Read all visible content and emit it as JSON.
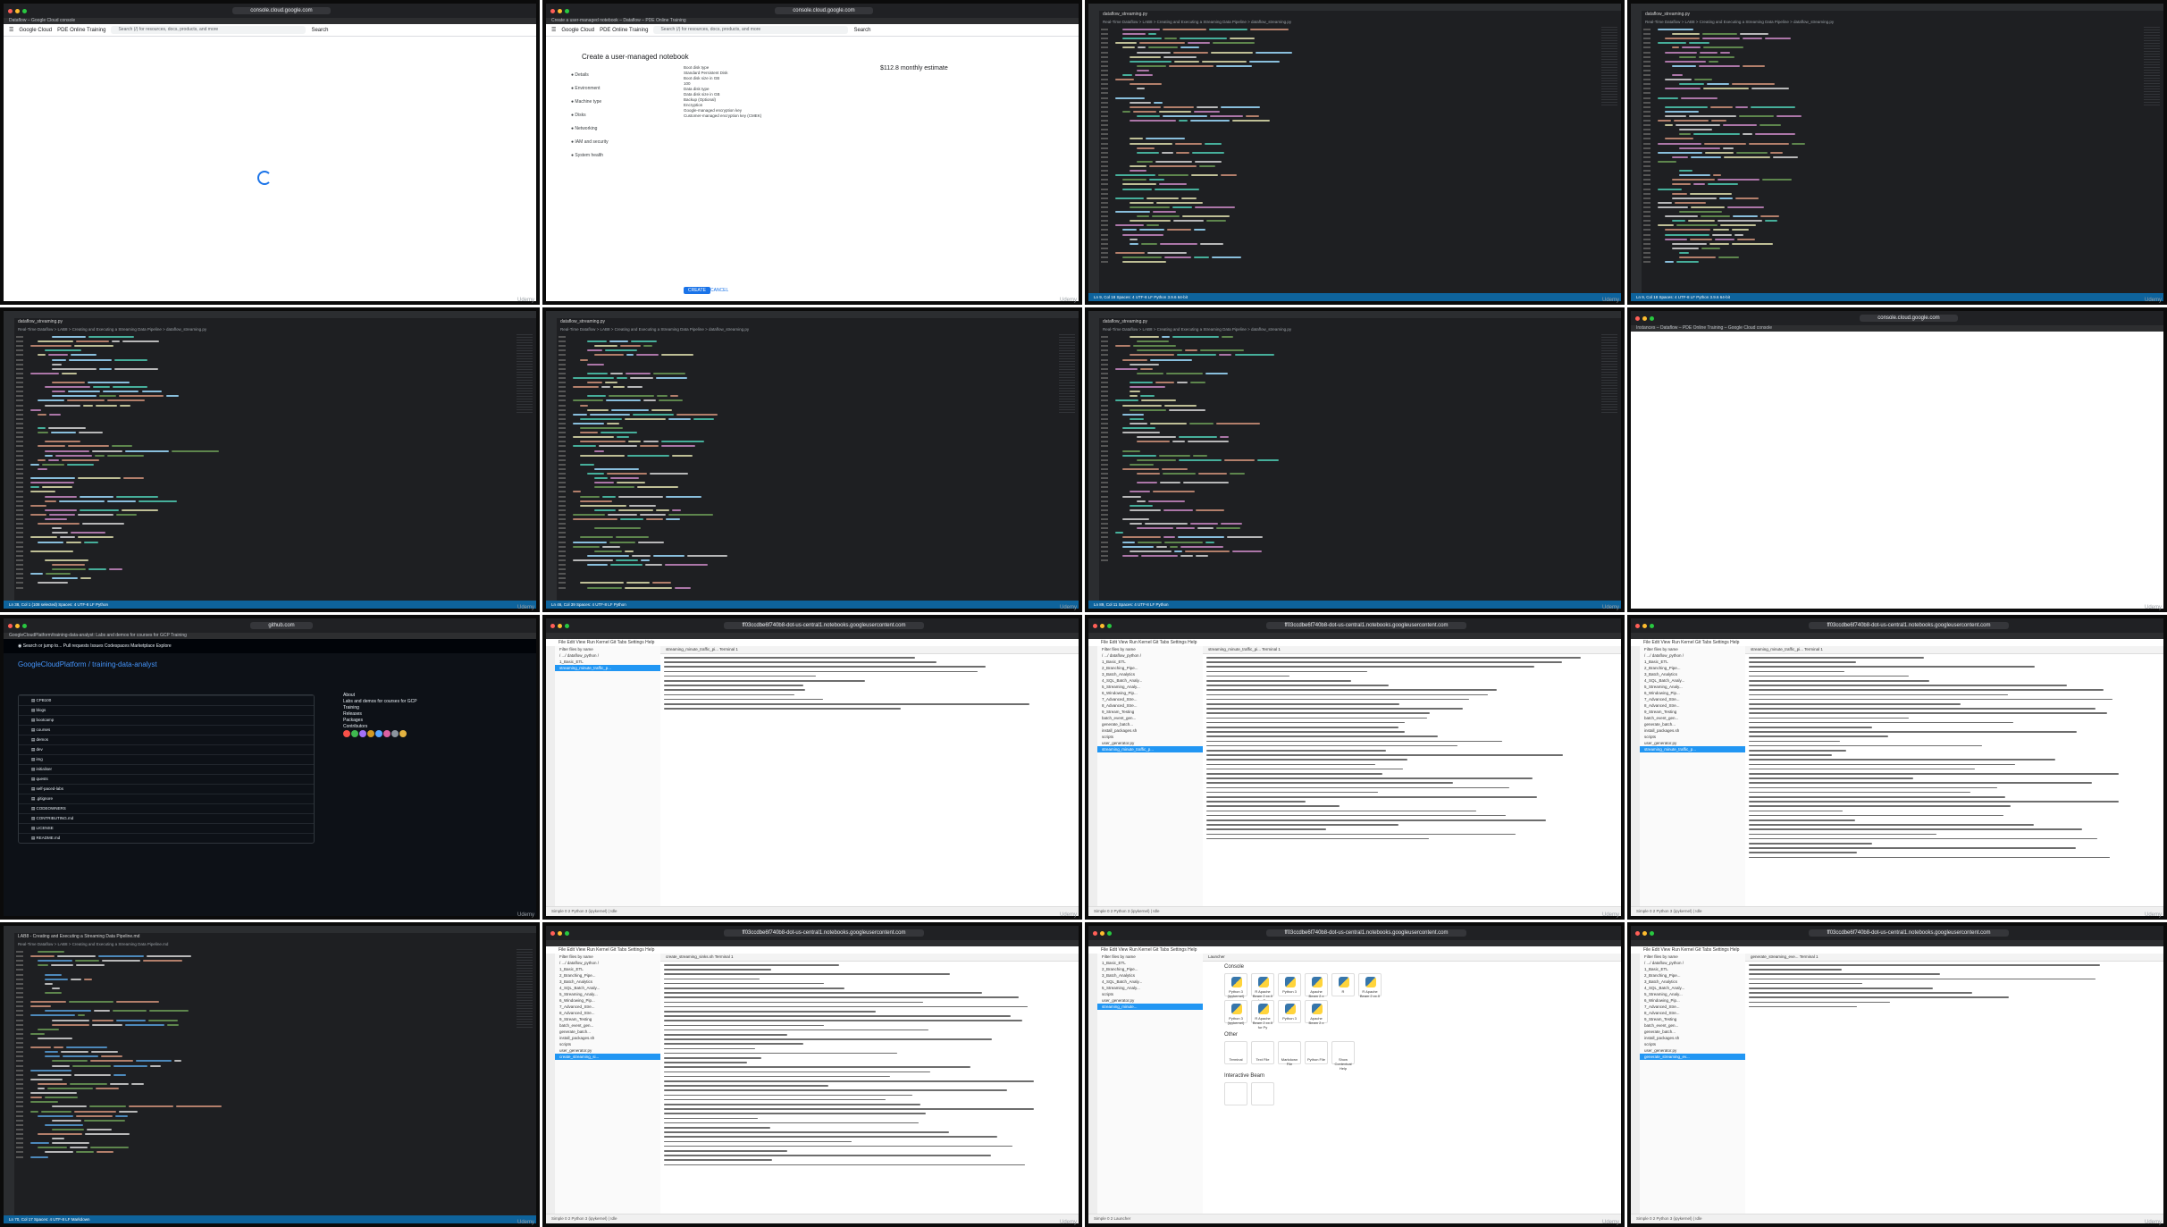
{
  "brand": {
    "watermark": "Udemy"
  },
  "tiles": [
    {
      "kind": "gcp-loading",
      "url": "console.cloud.google.com",
      "tab": "Dataflow – Google Cloud console",
      "product": "Google Cloud",
      "project": "PDE Online Training",
      "search_placeholder": "Search (/) for resources, docs, products, and more",
      "search_button": "Search"
    },
    {
      "kind": "gcp-notebook",
      "url": "console.cloud.google.com",
      "tab": "Create a user-managed notebook – Dataflow – PDE Online Training",
      "product": "Google Cloud",
      "project": "PDE Online Training",
      "search_placeholder": "Search (/) for resources, docs, products, and more",
      "search_button": "Search",
      "title": "Create a user-managed notebook",
      "steps": [
        "Details",
        "Environment",
        "Machine type",
        "Disks",
        "Networking",
        "IAM and security",
        "System health"
      ],
      "form_lines": [
        "Boot disk type",
        "Standard Persistent Disk",
        "Boot disk size in GB",
        "100",
        "Data disk type",
        "Data disk size in GB",
        "Backup (Optional)",
        "Encryption",
        "Google-managed encryption key",
        "Customer-managed encryption key (CMEK)"
      ],
      "estimate": "$112.8 monthly estimate",
      "create": "CREATE",
      "cancel": "CANCEL"
    },
    {
      "kind": "vscode",
      "tab": "dataflow_streaming.py",
      "crumb": "Real-Time Dataflow > LAB8 > Creating and Executing a Streaming Data Pipeline > dataflow_streaming.py",
      "status": "Ln 9, Col 18   Spaces: 4   UTF-8   LF   Python   3.9.6 64-bit",
      "lines": 52,
      "seed": 1
    },
    {
      "kind": "vscode",
      "tab": "dataflow_streaming.py",
      "crumb": "Real-Time Dataflow > LAB8 > Creating and Executing a Streaming Data Pipeline > dataflow_streaming.py",
      "status": "Ln 9, Col 18   Spaces: 4   UTF-8   LF   Python   3.9.6 64-bit",
      "lines": 52,
      "seed": 2
    },
    {
      "kind": "vscode",
      "tab": "dataflow_streaming.py",
      "crumb": "Real-Time Dataflow > LAB8 > Creating and Executing a Streaming Data Pipeline > dataflow_streaming.py",
      "status": "Ln 38, Col 1 (108 selected)   Spaces: 4   UTF-8   LF   Python",
      "lines": 56,
      "seed": 3
    },
    {
      "kind": "vscode",
      "tab": "dataflow_streaming.py",
      "crumb": "Real-Time Dataflow > LAB8 > Creating and Executing a Streaming Data Pipeline > dataflow_streaming.py",
      "status": "Ln 46, Col 39   Spaces: 4   UTF-8   LF   Python",
      "lines": 56,
      "seed": 4
    },
    {
      "kind": "vscode",
      "tab": "dataflow_streaming.py",
      "crumb": "Real-Time Dataflow > LAB8 > Creating and Executing a Streaming Data Pipeline > dataflow_streaming.py",
      "status": "Ln 89, Col 11   Spaces: 4   UTF-8   LF   Python",
      "lines": 50,
      "seed": 5
    },
    {
      "kind": "gcp-blank",
      "url": "console.cloud.google.com",
      "tab": "Instances – Dataflow – PDE Online Training – Google Cloud console"
    },
    {
      "kind": "github",
      "url": "github.com",
      "tab": "GoogleCloudPlatform/training-data-analyst: Labs and demos for courses for GCP Training",
      "nav": "Pull requests   Issues   Codespaces   Marketplace   Explore",
      "repo": "GoogleCloudPlatform / training-data-analyst",
      "files": [
        "CPB100",
        "blogs",
        "bootcamp",
        "courses",
        "demos",
        "dev",
        "img",
        "initialiser",
        "quests",
        "self-paced-labs",
        ".gitignore",
        "CODEOWNERS",
        "CONTRIBUTING.md",
        "LICENSE",
        "README.md"
      ],
      "about_title": "About",
      "about_text": "Labs and demos for courses for GCP Training",
      "releases": "Releases",
      "packages": "Packages",
      "contributors": "Contributors"
    },
    {
      "kind": "jupyter-term",
      "url": "ff03ccdbe6f740b8-dot-us-central1.notebooks.googleusercontent.com",
      "tabs": "streaming_minute_traffic_pi...   Terminal 1",
      "file_sel": "streaming_minute_traffic_p...",
      "density": 12,
      "status": "Simple   0  2  Python 3 (ipykernel) | Idle"
    },
    {
      "kind": "jupyter-term",
      "url": "ff03ccdbe6f740b8-dot-us-central1.notebooks.googleusercontent.com",
      "tabs": "streaming_minute_traffic_pi...   Terminal 1",
      "file_sel": "streaming_minute_traffic_p...",
      "density": 40,
      "status": "Simple   0  2  Python 3 (ipykernel) | Idle"
    },
    {
      "kind": "jupyter-term",
      "url": "ff03ccdbe6f740b8-dot-us-central1.notebooks.googleusercontent.com",
      "tabs": "streaming_minute_traffic_pi...   Terminal 1",
      "file_sel": "streaming_minute_traffic_p...",
      "density": 44,
      "status": "Simple   0  2  Python 3 (ipykernel) | Idle"
    },
    {
      "kind": "vscode-md",
      "tab": "LAB8 - Creating and Executing a Streaming Data Pipeline.md",
      "crumb": "Real-Time Dataflow > LAB8 > Creating and Executing a Streaming Data Pipeline.md",
      "status": "Ln 70, Col 17   Spaces: 4   UTF-8   LF   Markdown",
      "lines": 46,
      "seed": 6
    },
    {
      "kind": "jupyter-term",
      "url": "ff03ccdbe6f740b8-dot-us-central1.notebooks.googleusercontent.com",
      "tabs": "create_streaming_sinks.sh   Terminal 1",
      "file_sel": "create_streaming_si...",
      "density": 44,
      "status": "Simple   0  2  Python 3 (ipykernel) | Idle"
    },
    {
      "kind": "jupyter-launcher",
      "url": "ff03ccdbe6f740b8-dot-us-central1.notebooks.googleusercontent.com",
      "tabs": "Launcher",
      "section_console": "Console",
      "section_other": "Other",
      "section_beam": "Interactive Beam",
      "icons": [
        "Python 3 (ipykernel)",
        "R Apache Beam 2.xx.0 for Py",
        "Python 3",
        "Apache Beam 2.x",
        "R",
        "R Apache Beam 2.xx.0",
        "Terminal",
        "Text File",
        "Markdown File",
        "Python File",
        "Show Contextual Help"
      ],
      "file_sel": "streaming_minute..."
    },
    {
      "kind": "jupyter-term",
      "url": "ff03ccdbe6f740b8-dot-us-central1.notebooks.googleusercontent.com",
      "tabs": "generate_streaming_eve...   Terminal 1",
      "file_sel": "generate_streaming_ev...",
      "density": 10,
      "status": "Simple   0  2  Python 3 (ipykernel) | Idle"
    }
  ]
}
